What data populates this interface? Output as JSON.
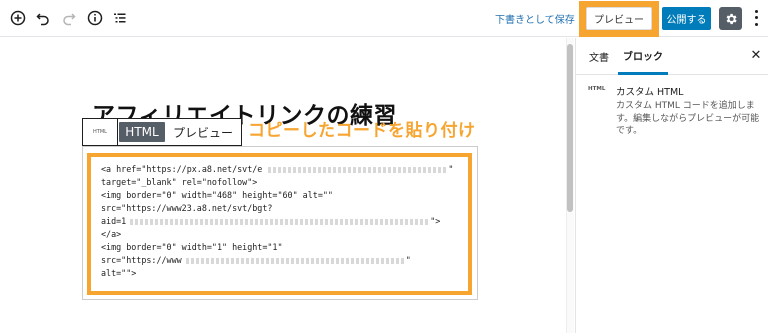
{
  "toolbar": {
    "add_icon": "plus-circle-icon",
    "undo_icon": "undo-icon",
    "redo_icon": "redo-icon",
    "info_icon": "info-icon",
    "outline_icon": "list-view-icon",
    "save_draft_label": "下書きとして保存",
    "preview_label": "プレビュー",
    "publish_label": "公開する",
    "settings_icon": "gear-icon",
    "more_icon": "more-vertical-icon"
  },
  "editor": {
    "post_title": "アフィリエイトリンクの練習",
    "block_toolbar": {
      "html_icon_label": "HTML",
      "html_tab": "HTML",
      "preview_tab": "プレビュー"
    },
    "annotation": "コピーしたコードを貼り付け",
    "code_lines": [
      "<a href=\"https://px.a8.net/svt/e",
      "target=\"_blank\" rel=\"nofollow\">",
      "<img border=\"0\" width=\"468\" height=\"60\" alt=\"\"",
      "src=\"https://www23.a8.net/svt/bgt?",
      "aid=1",
      "</a>",
      "<img border=\"0\" width=\"1\" height=\"1\"",
      "src=\"https://www",
      "alt=\"\">"
    ]
  },
  "sidebar": {
    "tabs": [
      "文書",
      "ブロック"
    ],
    "active_tab": "ブロック",
    "close_icon": "close-icon",
    "block_icon_label": "HTML",
    "block_title": "カスタム HTML",
    "block_description": "カスタム HTML コードを追加します。編集しながらプレビューが可能です。"
  },
  "colors": {
    "highlight": "#f7a531",
    "publish": "#007cba",
    "link": "#2271b1",
    "dark": "#555d66"
  }
}
